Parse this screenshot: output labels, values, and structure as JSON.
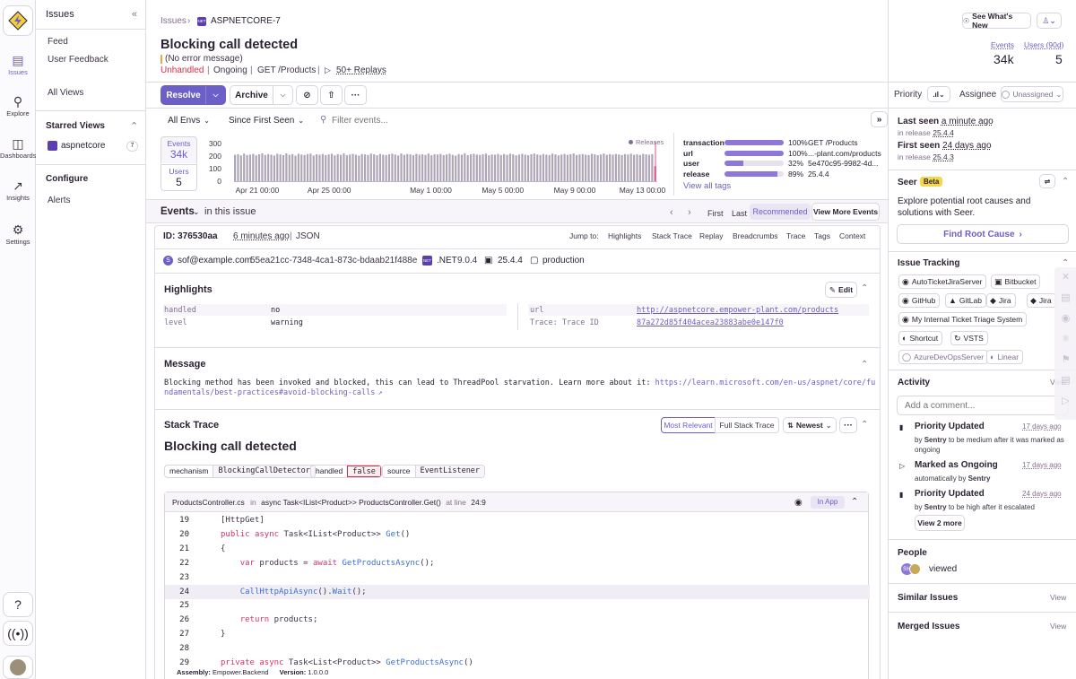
{
  "rail": {
    "items": [
      {
        "label": "Issues",
        "icon": "inbox-icon"
      },
      {
        "label": "Explore",
        "icon": "search-icon"
      },
      {
        "label": "Dashboards",
        "icon": "dashboard-icon"
      },
      {
        "label": "Insights",
        "icon": "graph-icon"
      },
      {
        "label": "Settings",
        "icon": "gear-icon"
      }
    ]
  },
  "nav": {
    "title": "Issues",
    "items": [
      "Feed",
      "User Feedback",
      "All Views"
    ],
    "starred_title": "Starred Views",
    "starred": {
      "name": "aspnetcore",
      "count": "7"
    },
    "configure_title": "Configure",
    "configure_items": [
      "Alerts"
    ]
  },
  "header": {
    "breadcrumb_root": "Issues",
    "breadcrumb_current": "ASPNETCORE-7",
    "platform_badge": "NET",
    "whats_new": "See What's New",
    "title": "Blocking call detected",
    "subtitle": "(No error message)",
    "meta": {
      "unhandled": "Unhandled",
      "status": "Ongoing",
      "transaction": "GET /Products",
      "replays": "50+ Replays"
    },
    "stats": {
      "events_label": "Events",
      "events_value": "34k",
      "users_label": "Users (90d)",
      "users_value": "5"
    }
  },
  "actions": {
    "resolve": "Resolve",
    "archive": "Archive",
    "priority_label": "Priority",
    "assignee_label": "Assignee",
    "assignee_value": "Unassigned"
  },
  "filters": {
    "envs": "All Envs",
    "range": "Since First Seen",
    "search_placeholder": "Filter events..."
  },
  "graph": {
    "events_label": "Events",
    "events_value": "34k",
    "users_label": "Users",
    "users_value": "5",
    "releases_label": "Releases"
  },
  "chart_data": {
    "type": "bar",
    "ylim": [
      0,
      300
    ],
    "yticks": [
      "300",
      "200",
      "100",
      "0"
    ],
    "x_tick_labels": [
      "Apr 21 00:00",
      "Apr 25 00:00",
      "May 1 00:00",
      "May 5 00:00",
      "May 9 00:00",
      "May 13 00:00"
    ],
    "values": [
      210,
      215,
      205,
      220,
      208,
      212,
      218,
      206,
      214,
      222,
      209,
      216,
      211,
      204,
      219,
      213,
      207,
      221,
      210,
      215,
      203,
      218,
      212,
      209,
      216,
      220,
      205,
      214,
      211,
      217,
      208,
      213,
      219,
      206,
      215,
      210,
      222,
      207,
      212,
      218,
      211,
      204,
      216,
      213,
      209,
      220,
      214,
      206,
      217,
      211,
      208,
      215,
      219,
      212,
      205,
      221,
      210,
      216,
      213,
      207,
      218,
      211,
      214,
      209,
      220,
      206,
      215,
      212,
      217,
      208,
      213,
      219,
      210,
      204,
      216,
      211,
      222,
      207,
      214,
      218,
      212,
      209,
      215,
      220,
      206,
      213,
      211,
      217,
      208,
      216,
      210,
      219,
      214,
      205,
      212,
      218,
      211,
      207,
      215,
      220,
      213,
      209,
      216,
      211,
      208,
      219,
      214,
      206,
      212,
      217,
      210,
      215,
      221,
      208,
      213,
      216,
      211,
      209,
      218,
      214,
      207,
      212,
      220,
      210,
      215,
      211,
      217,
      213,
      208,
      216,
      212,
      219,
      210,
      214,
      209,
      218,
      213,
      211,
      216,
      120
    ]
  },
  "tags": {
    "rows": [
      {
        "key": "transaction",
        "pct": "100%",
        "value": "GET /Products",
        "fill": 1.0
      },
      {
        "key": "url",
        "pct": "100%",
        "value": "...-plant.com/products",
        "fill": 1.0
      },
      {
        "key": "user",
        "pct": "32%",
        "value": "5e470c95-9982-4d...",
        "fill": 0.32
      },
      {
        "key": "release",
        "pct": "89%",
        "value": "25.4.4",
        "fill": 0.89
      }
    ],
    "view_all": "View all tags"
  },
  "events_bar": {
    "title": "Events",
    "suffix": "in this issue",
    "first": "First",
    "last": "Last",
    "recommended": "Recommended",
    "view_more": "View More Events"
  },
  "event": {
    "id_label": "ID: 376530aa",
    "time": "6 minutes ago",
    "json": "JSON",
    "jump_to": "Jump to:",
    "jumps": [
      "Highlights",
      "Stack Trace",
      "Replay",
      "Breadcrumbs",
      "Trace",
      "Tags",
      "Context"
    ],
    "user_initial": "S",
    "user": "sof@example.com",
    "trace_id_short": "55ea21cc-7348-4ca1-873c-bdaab21f488e",
    "sdk_badge": "NET",
    "sdk": ".NET",
    "sdk_version": "9.0.4",
    "release": "25.4.4",
    "environment": "production"
  },
  "highlights": {
    "title": "Highlights",
    "edit": "Edit",
    "left": [
      {
        "k": "handled",
        "v": "no"
      },
      {
        "k": "level",
        "v": "warning"
      }
    ],
    "right": [
      {
        "k": "url",
        "v": "http://aspnetcore.empower-plant.com/products"
      },
      {
        "k": "Trace: Trace ID",
        "v": "87a272d85f404acea23883abe0e147f0"
      }
    ]
  },
  "message": {
    "title": "Message",
    "line1": "Blocking method has been invoked and blocked, this can lead to ThreadPool starvation. Learn more about it: ",
    "link1": "https://learn.microsoft.com/en-us/aspnet/core/fu",
    "link2": "ndamentals/best-practices#avoid-blocking-calls"
  },
  "stack": {
    "title": "Stack Trace",
    "most_relevant": "Most Relevant",
    "full": "Full Stack Trace",
    "newest": "Newest",
    "exception_title": "Blocking call detected",
    "mech_k": "mechanism",
    "mech_v": "BlockingCallDetector",
    "handled_k": "handled",
    "handled_v": "false",
    "source_k": "source",
    "source_v": "EventListener",
    "frame_file": "ProductsController.cs",
    "frame_in": "in",
    "frame_fn": "async Task<IList<Product>> ProductsController.Get()",
    "frame_at": "at line",
    "frame_line": "24:9",
    "in_app": "In App",
    "lines": [
      {
        "n": "19",
        "t": "[HttpGet]"
      },
      {
        "n": "20",
        "t": "public async Task<IList<Product>> Get()"
      },
      {
        "n": "21",
        "t": "{"
      },
      {
        "n": "22",
        "t": "    var products = await GetProductsAsync();"
      },
      {
        "n": "23",
        "t": ""
      },
      {
        "n": "24",
        "t": "    CallHttpApiAsync().Wait();"
      },
      {
        "n": "25",
        "t": ""
      },
      {
        "n": "26",
        "t": "    return products;"
      },
      {
        "n": "27",
        "t": "}"
      },
      {
        "n": "28",
        "t": ""
      },
      {
        "n": "29",
        "t": "private async Task<List<Product>> GetProductsAsync()"
      }
    ],
    "assembly_k": "Assembly:",
    "assembly_v": "Empower.Backend",
    "version_k": "Version:",
    "version_v": "1.0.0.0"
  },
  "side": {
    "last_seen_k": "Last seen",
    "last_seen_v": "a minute ago",
    "last_release_k": "in release",
    "last_release_v": "25.4.4",
    "first_seen_k": "First seen",
    "first_seen_v": "24 days ago",
    "first_release_k": "in release",
    "first_release_v": "25.4.3",
    "seer_title": "Seer",
    "seer_badge": "Beta",
    "seer_text": "Explore potential root causes and solutions with Seer.",
    "find_root": "Find Root Cause",
    "tracking_title": "Issue Tracking",
    "trackers": [
      "AutoTicketJiraServer",
      "Bitbucket",
      "GitHub",
      "GitLab",
      "Jira",
      "Jira",
      "My Internal Ticket Triage System",
      "Shortcut",
      "VSTS",
      "AzureDevOpsServer",
      "Linear"
    ],
    "activity_title": "Activity",
    "activity_view": "View",
    "comment_placeholder": "Add a comment...",
    "activities": [
      {
        "title": "Priority Updated",
        "time": "17 days ago",
        "by": "by",
        "who": "Sentry",
        "desc": "to be medium after it was marked as ongoing"
      },
      {
        "title": "Marked as Ongoing",
        "time": "17 days ago",
        "by": "automatically by",
        "who": "Sentry",
        "desc": ""
      },
      {
        "title": "Priority Updated",
        "time": "24 days ago",
        "by": "by",
        "who": "Sentry",
        "desc": "to be high after it escalated"
      }
    ],
    "view_more": "View 2 more",
    "people_title": "People",
    "people_avatar": "SH",
    "people_viewed": "viewed",
    "similar": "Similar Issues",
    "similar_view": "View",
    "merged": "Merged Issues",
    "merged_view": "View"
  },
  "colors": {
    "accent": "#6c5fc7",
    "unhandled": "#d92b4b",
    "bar": "#aea6b7"
  }
}
